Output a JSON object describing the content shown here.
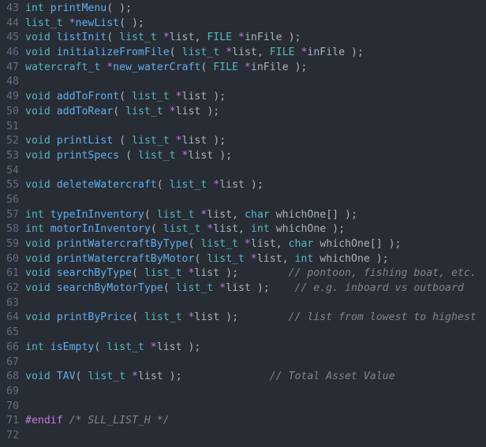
{
  "editor": {
    "language": "C header",
    "theme": "One Dark",
    "background_color": "#282c34",
    "gutter_color": "#636d83",
    "colors": {
      "type": "#56b6c2",
      "function": "#61afef",
      "punctuation": "#abb2bf",
      "variable": "#abb2bf",
      "pointer_star": "#c678dd",
      "preprocessor": "#c678dd",
      "comment": "#7f848e"
    },
    "first_line_number": 43,
    "last_line_number": 72
  },
  "lines": [
    {
      "n": "43",
      "tokens": [
        {
          "t": "int",
          "c": "type"
        },
        {
          "t": " ",
          "c": "punct"
        },
        {
          "t": "printMenu",
          "c": "fn"
        },
        {
          "t": "( );",
          "c": "punct"
        }
      ]
    },
    {
      "n": "44",
      "tokens": [
        {
          "t": "list_t ",
          "c": "type"
        },
        {
          "t": "*",
          "c": "star"
        },
        {
          "t": "newList",
          "c": "fn"
        },
        {
          "t": "( );",
          "c": "punct"
        }
      ]
    },
    {
      "n": "45",
      "tokens": [
        {
          "t": "void",
          "c": "type"
        },
        {
          "t": " ",
          "c": "punct"
        },
        {
          "t": "listInit",
          "c": "fn"
        },
        {
          "t": "( ",
          "c": "punct"
        },
        {
          "t": "list_t ",
          "c": "type"
        },
        {
          "t": "*",
          "c": "star"
        },
        {
          "t": "list",
          "c": "var"
        },
        {
          "t": ", ",
          "c": "punct"
        },
        {
          "t": "FILE ",
          "c": "type"
        },
        {
          "t": "*",
          "c": "star"
        },
        {
          "t": "inFile",
          "c": "var"
        },
        {
          "t": " );",
          "c": "punct"
        }
      ]
    },
    {
      "n": "46",
      "tokens": [
        {
          "t": "void",
          "c": "type"
        },
        {
          "t": " ",
          "c": "punct"
        },
        {
          "t": "initializeFromFile",
          "c": "fn"
        },
        {
          "t": "( ",
          "c": "punct"
        },
        {
          "t": "list_t ",
          "c": "type"
        },
        {
          "t": "*",
          "c": "star"
        },
        {
          "t": "list",
          "c": "var"
        },
        {
          "t": ", ",
          "c": "punct"
        },
        {
          "t": "FILE ",
          "c": "type"
        },
        {
          "t": "*",
          "c": "star"
        },
        {
          "t": "inFile",
          "c": "var"
        },
        {
          "t": " );",
          "c": "punct"
        }
      ]
    },
    {
      "n": "47",
      "tokens": [
        {
          "t": "watercraft_t ",
          "c": "type"
        },
        {
          "t": "*",
          "c": "star"
        },
        {
          "t": "new_waterCraft",
          "c": "fn"
        },
        {
          "t": "( ",
          "c": "punct"
        },
        {
          "t": "FILE ",
          "c": "type"
        },
        {
          "t": "*",
          "c": "star"
        },
        {
          "t": "inFile",
          "c": "var"
        },
        {
          "t": " );",
          "c": "punct"
        }
      ]
    },
    {
      "n": "48",
      "tokens": []
    },
    {
      "n": "49",
      "tokens": [
        {
          "t": "void",
          "c": "type"
        },
        {
          "t": " ",
          "c": "punct"
        },
        {
          "t": "addToFront",
          "c": "fn"
        },
        {
          "t": "( ",
          "c": "punct"
        },
        {
          "t": "list_t ",
          "c": "type"
        },
        {
          "t": "*",
          "c": "star"
        },
        {
          "t": "list",
          "c": "var"
        },
        {
          "t": " );",
          "c": "punct"
        }
      ]
    },
    {
      "n": "50",
      "tokens": [
        {
          "t": "void",
          "c": "type"
        },
        {
          "t": " ",
          "c": "punct"
        },
        {
          "t": "addToRear",
          "c": "fn"
        },
        {
          "t": "( ",
          "c": "punct"
        },
        {
          "t": "list_t ",
          "c": "type"
        },
        {
          "t": "*",
          "c": "star"
        },
        {
          "t": "list",
          "c": "var"
        },
        {
          "t": " );",
          "c": "punct"
        }
      ]
    },
    {
      "n": "51",
      "tokens": []
    },
    {
      "n": "52",
      "tokens": [
        {
          "t": "void",
          "c": "type"
        },
        {
          "t": " ",
          "c": "punct"
        },
        {
          "t": "printList",
          "c": "fn"
        },
        {
          "t": " ( ",
          "c": "punct"
        },
        {
          "t": "list_t ",
          "c": "type"
        },
        {
          "t": "*",
          "c": "star"
        },
        {
          "t": "list",
          "c": "var"
        },
        {
          "t": " );",
          "c": "punct"
        }
      ]
    },
    {
      "n": "53",
      "tokens": [
        {
          "t": "void",
          "c": "type"
        },
        {
          "t": " ",
          "c": "punct"
        },
        {
          "t": "printSpecs",
          "c": "fn"
        },
        {
          "t": " ( ",
          "c": "punct"
        },
        {
          "t": "list_t ",
          "c": "type"
        },
        {
          "t": "*",
          "c": "star"
        },
        {
          "t": "list",
          "c": "var"
        },
        {
          "t": " );",
          "c": "punct"
        }
      ]
    },
    {
      "n": "54",
      "tokens": []
    },
    {
      "n": "55",
      "tokens": [
        {
          "t": "void",
          "c": "type"
        },
        {
          "t": " ",
          "c": "punct"
        },
        {
          "t": "deleteWatercraft",
          "c": "fn"
        },
        {
          "t": "( ",
          "c": "punct"
        },
        {
          "t": "list_t ",
          "c": "type"
        },
        {
          "t": "*",
          "c": "star"
        },
        {
          "t": "list",
          "c": "var"
        },
        {
          "t": " );",
          "c": "punct"
        }
      ]
    },
    {
      "n": "56",
      "tokens": []
    },
    {
      "n": "57",
      "tokens": [
        {
          "t": "int",
          "c": "type"
        },
        {
          "t": " ",
          "c": "punct"
        },
        {
          "t": "typeInInventory",
          "c": "fn"
        },
        {
          "t": "( ",
          "c": "punct"
        },
        {
          "t": "list_t ",
          "c": "type"
        },
        {
          "t": "*",
          "c": "star"
        },
        {
          "t": "list",
          "c": "var"
        },
        {
          "t": ", ",
          "c": "punct"
        },
        {
          "t": "char",
          "c": "type"
        },
        {
          "t": " ",
          "c": "punct"
        },
        {
          "t": "whichOne",
          "c": "var"
        },
        {
          "t": "[] );",
          "c": "punct"
        }
      ]
    },
    {
      "n": "58",
      "tokens": [
        {
          "t": "int",
          "c": "type"
        },
        {
          "t": " ",
          "c": "punct"
        },
        {
          "t": "motorInInventory",
          "c": "fn"
        },
        {
          "t": "( ",
          "c": "punct"
        },
        {
          "t": "list_t ",
          "c": "type"
        },
        {
          "t": "*",
          "c": "star"
        },
        {
          "t": "list",
          "c": "var"
        },
        {
          "t": ", ",
          "c": "punct"
        },
        {
          "t": "int",
          "c": "type"
        },
        {
          "t": " ",
          "c": "punct"
        },
        {
          "t": "whichOne",
          "c": "var"
        },
        {
          "t": " );",
          "c": "punct"
        }
      ]
    },
    {
      "n": "59",
      "tokens": [
        {
          "t": "void",
          "c": "type"
        },
        {
          "t": " ",
          "c": "punct"
        },
        {
          "t": "printWatercraftByType",
          "c": "fn"
        },
        {
          "t": "( ",
          "c": "punct"
        },
        {
          "t": "list_t ",
          "c": "type"
        },
        {
          "t": "*",
          "c": "star"
        },
        {
          "t": "list",
          "c": "var"
        },
        {
          "t": ", ",
          "c": "punct"
        },
        {
          "t": "char",
          "c": "type"
        },
        {
          "t": " ",
          "c": "punct"
        },
        {
          "t": "whichOne",
          "c": "var"
        },
        {
          "t": "[] );",
          "c": "punct"
        }
      ]
    },
    {
      "n": "60",
      "tokens": [
        {
          "t": "void",
          "c": "type"
        },
        {
          "t": " ",
          "c": "punct"
        },
        {
          "t": "printWatercraftByMotor",
          "c": "fn"
        },
        {
          "t": "( ",
          "c": "punct"
        },
        {
          "t": "list_t ",
          "c": "type"
        },
        {
          "t": "*",
          "c": "star"
        },
        {
          "t": "list",
          "c": "var"
        },
        {
          "t": ", ",
          "c": "punct"
        },
        {
          "t": "int",
          "c": "type"
        },
        {
          "t": " ",
          "c": "punct"
        },
        {
          "t": "whichOne",
          "c": "var"
        },
        {
          "t": " );",
          "c": "punct"
        }
      ]
    },
    {
      "n": "61",
      "tokens": [
        {
          "t": "void",
          "c": "type"
        },
        {
          "t": " ",
          "c": "punct"
        },
        {
          "t": "searchByType",
          "c": "fn"
        },
        {
          "t": "( ",
          "c": "punct"
        },
        {
          "t": "list_t ",
          "c": "type"
        },
        {
          "t": "*",
          "c": "star"
        },
        {
          "t": "list",
          "c": "var"
        },
        {
          "t": " );",
          "c": "punct"
        },
        {
          "t": "        ",
          "c": "punct"
        },
        {
          "t": "// pontoon, fishing boat, etc.",
          "c": "comment"
        }
      ]
    },
    {
      "n": "62",
      "tokens": [
        {
          "t": "void",
          "c": "type"
        },
        {
          "t": " ",
          "c": "punct"
        },
        {
          "t": "searchByMotorType",
          "c": "fn"
        },
        {
          "t": "( ",
          "c": "punct"
        },
        {
          "t": "list_t ",
          "c": "type"
        },
        {
          "t": "*",
          "c": "star"
        },
        {
          "t": "list",
          "c": "var"
        },
        {
          "t": " );",
          "c": "punct"
        },
        {
          "t": "    ",
          "c": "punct"
        },
        {
          "t": "// e.g. inboard vs outboard",
          "c": "comment"
        }
      ]
    },
    {
      "n": "63",
      "tokens": []
    },
    {
      "n": "64",
      "tokens": [
        {
          "t": "void",
          "c": "type"
        },
        {
          "t": " ",
          "c": "punct"
        },
        {
          "t": "printByPrice",
          "c": "fn"
        },
        {
          "t": "( ",
          "c": "punct"
        },
        {
          "t": "list_t ",
          "c": "type"
        },
        {
          "t": "*",
          "c": "star"
        },
        {
          "t": "list",
          "c": "var"
        },
        {
          "t": " );",
          "c": "punct"
        },
        {
          "t": "        ",
          "c": "punct"
        },
        {
          "t": "// list from lowest to highest",
          "c": "comment"
        }
      ]
    },
    {
      "n": "65",
      "tokens": []
    },
    {
      "n": "66",
      "tokens": [
        {
          "t": "int",
          "c": "type"
        },
        {
          "t": " ",
          "c": "punct"
        },
        {
          "t": "isEmpty",
          "c": "fn"
        },
        {
          "t": "( ",
          "c": "punct"
        },
        {
          "t": "list_t ",
          "c": "type"
        },
        {
          "t": "*",
          "c": "star"
        },
        {
          "t": "list",
          "c": "var"
        },
        {
          "t": " );",
          "c": "punct"
        }
      ]
    },
    {
      "n": "67",
      "tokens": []
    },
    {
      "n": "68",
      "tokens": [
        {
          "t": "void",
          "c": "type"
        },
        {
          "t": " ",
          "c": "punct"
        },
        {
          "t": "TAV",
          "c": "fn"
        },
        {
          "t": "( ",
          "c": "punct"
        },
        {
          "t": "list_t ",
          "c": "type"
        },
        {
          "t": "*",
          "c": "star"
        },
        {
          "t": "list",
          "c": "var"
        },
        {
          "t": " );",
          "c": "punct"
        },
        {
          "t": "              ",
          "c": "punct"
        },
        {
          "t": "// Total Asset Value",
          "c": "comment"
        }
      ]
    },
    {
      "n": "69",
      "tokens": []
    },
    {
      "n": "70",
      "tokens": []
    },
    {
      "n": "71",
      "tokens": [
        {
          "t": "#endif",
          "c": "preproc"
        },
        {
          "t": " ",
          "c": "punct"
        },
        {
          "t": "/* SLL_LIST_H */",
          "c": "comment"
        }
      ]
    },
    {
      "n": "72",
      "tokens": []
    }
  ]
}
